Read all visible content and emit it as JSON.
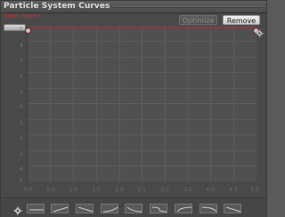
{
  "window": {
    "title": "Particle System Curves"
  },
  "toolbar": {
    "curve_label": "Start Speed",
    "optimize_label": "Optimize",
    "remove_label": "Remove"
  },
  "plot": {
    "y_ticks": [
      "5",
      "4",
      "3",
      "2",
      "1",
      "0",
      "1",
      "2",
      "3",
      "4",
      "5"
    ],
    "x_ticks": [
      "0.0",
      "0.5",
      "1.0",
      "1.5",
      "2.0",
      "2.5",
      "3.0",
      "3.5",
      "4.0",
      "4.5",
      "5.0"
    ]
  },
  "icons": {
    "settings": "gear-icon",
    "presets": [
      "flat-curve-icon",
      "ramp-up-icon",
      "ramp-down-icon",
      "ease-in-icon",
      "ease-out-icon",
      "s-curve-icon",
      "ramp-up-icon",
      "ramp-down-icon",
      "curve-icon"
    ]
  },
  "colors": {
    "curve": "#b22a2a",
    "label": "#c83232"
  }
}
